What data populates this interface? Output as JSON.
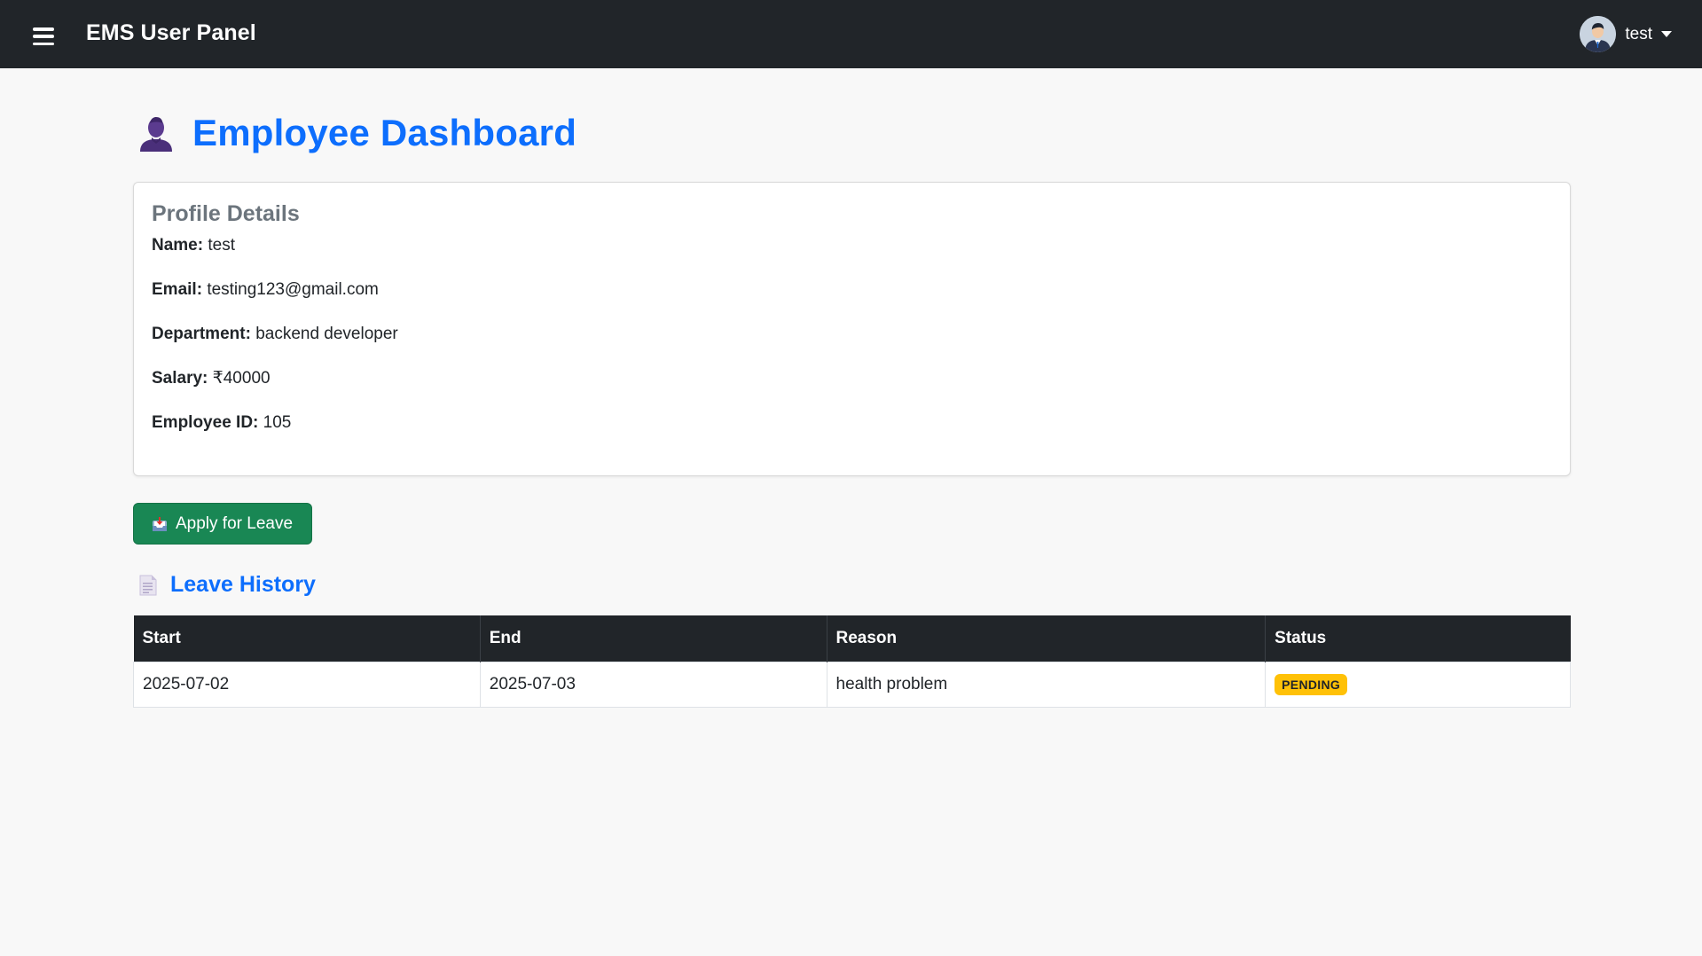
{
  "navbar": {
    "brand": "EMS User Panel",
    "user_name": "test"
  },
  "page": {
    "title": "Employee Dashboard"
  },
  "profile": {
    "title": "Profile Details",
    "fields": [
      {
        "label": "Name:",
        "value": "test"
      },
      {
        "label": "Email:",
        "value": "testing123@gmail.com"
      },
      {
        "label": "Department:",
        "value": "backend developer"
      },
      {
        "label": "Salary:",
        "value": "₹40000"
      },
      {
        "label": "Employee ID:",
        "value": "105"
      }
    ]
  },
  "actions": {
    "apply_leave_label": "Apply for Leave"
  },
  "leave_history": {
    "title": "Leave History",
    "columns": [
      "Start",
      "End",
      "Reason",
      "Status"
    ],
    "rows": [
      {
        "start": "2025-07-02",
        "end": "2025-07-03",
        "reason": "health problem",
        "status": "PENDING"
      }
    ]
  },
  "colors": {
    "navbar_bg": "#212529",
    "primary": "#0d6efd",
    "success": "#198754",
    "warning": "#ffc107",
    "muted": "#6c757d"
  },
  "icons": {
    "menu": "hamburger-menu-icon",
    "avatar": "user-avatar",
    "title": "person-silhouette-icon",
    "apply": "inbox-tray-icon",
    "history": "document-icon"
  }
}
